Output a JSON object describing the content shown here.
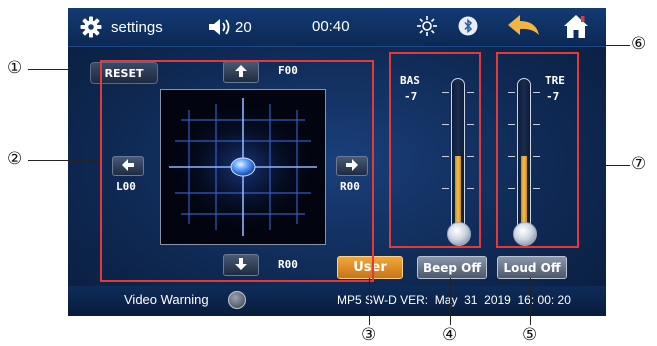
{
  "topbar": {
    "settings_label": "settings",
    "volume_value": "20",
    "time": "00:40",
    "icons": [
      "gear-icon",
      "speaker-icon",
      "brightness-icon",
      "bluetooth-icon",
      "back-arrow-icon",
      "home-icon"
    ]
  },
  "balance": {
    "reset_label": "RESET",
    "front_label": "F00",
    "rear_label": "R00",
    "left_label": "L00",
    "right_label": "R00"
  },
  "eq": {
    "bass_label": "BAS",
    "bass_value": "-7",
    "treble_label": "TRE",
    "treble_value": "-7"
  },
  "buttons": {
    "user_label": "User",
    "beep_label": "Beep Off",
    "loud_label": "Loud Off"
  },
  "bottombar": {
    "video_warning_label": "Video Warning",
    "version_text": "MP5 SW-D VER:  May  31  2019  16: 00: 20"
  },
  "callouts": {
    "c1": "①",
    "c2": "②",
    "c3": "③",
    "c4": "④",
    "c5": "⑤",
    "c6": "⑥",
    "c7": "⑦"
  },
  "colors": {
    "accent_orange": "#f0a838",
    "annotation_red": "#e23a3a",
    "slider_gold": "#f4c04a",
    "screen_blue": "#0f2a55"
  }
}
